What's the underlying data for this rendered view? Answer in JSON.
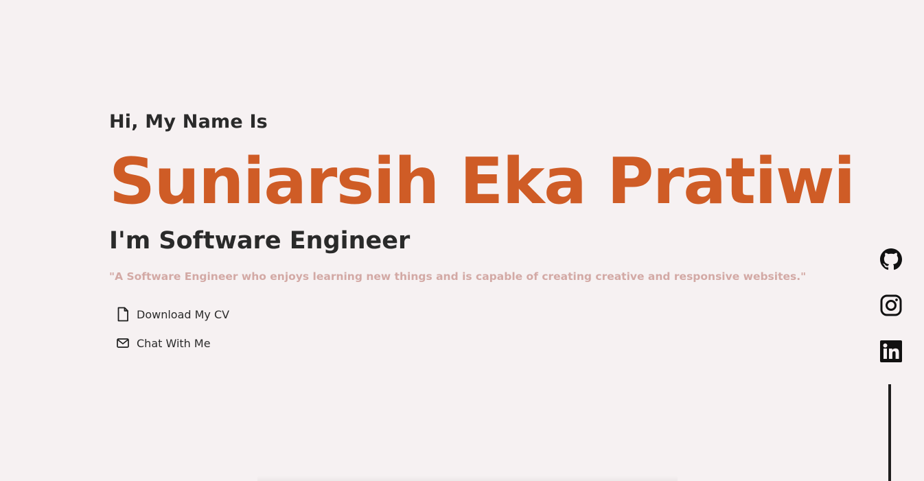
{
  "hero": {
    "greeting": "Hi, My Name Is",
    "name": "Suniarsih Eka Pratiwi",
    "role": "I'm Software Engineer",
    "quote": "\"A Software Engineer who enjoys learning new things and is capable of creating creative and responsive websites.\""
  },
  "actions": {
    "download_cv": {
      "label": "Download My CV",
      "icon": "file-icon"
    },
    "chat": {
      "label": "Chat With Me",
      "icon": "mail-icon"
    }
  },
  "social": [
    {
      "name": "github-icon"
    },
    {
      "name": "instagram-icon"
    },
    {
      "name": "linkedin-icon"
    }
  ],
  "colors": {
    "background": "#f6f1f2",
    "accent": "#cf5c26",
    "text": "#2a2a2a",
    "quote": "#d3a9a5"
  }
}
